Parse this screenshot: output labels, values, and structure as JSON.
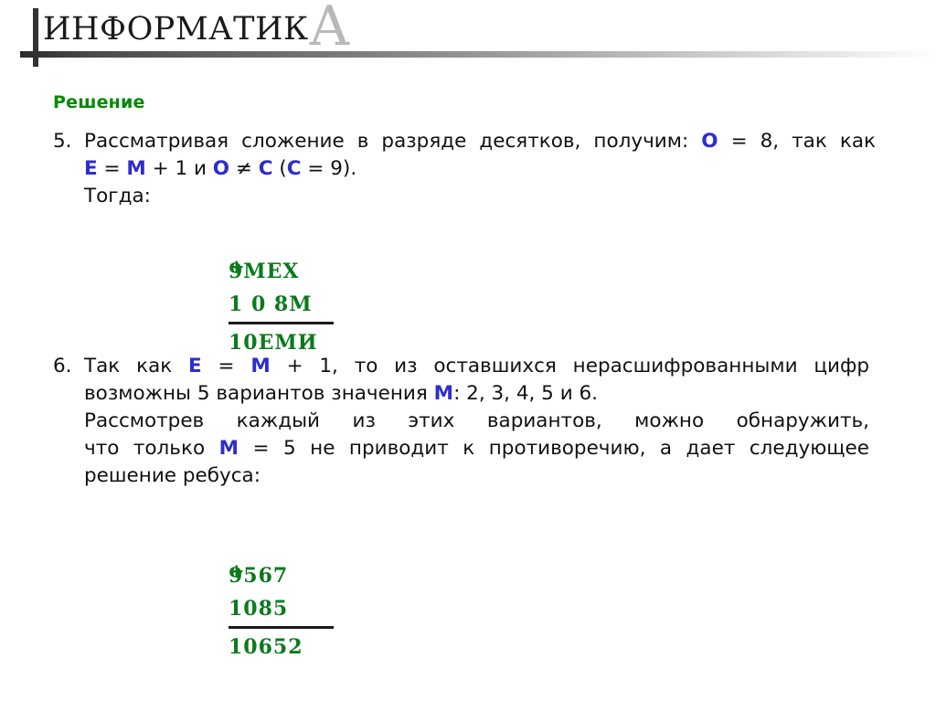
{
  "header": {
    "title_main": "ИНФОРМАТИК",
    "title_last_letter": "А",
    "rule_color_start": "#2b2b2b",
    "rule_color_end": "#ffffff",
    "bar_color": "#333333",
    "big_letter_color": "#b8b8b8"
  },
  "colors": {
    "accent_green": "#008a00",
    "sum_green": "#0a7a1c",
    "variable_blue": "#2d2dcf",
    "text_black": "#111111",
    "background": "#ffffff"
  },
  "section": {
    "title": "Решение"
  },
  "paragraphs": [
    {
      "number": "5.",
      "line1_a": "Рассматривая сложение в разряде десятков, получим: ",
      "line1_var": "О",
      "line1_b": " = 8, так как",
      "line2_v1": "Е",
      "line2_a": " = ",
      "line2_v2": "М",
      "line2_b": " + 1  и  ",
      "line2_v3": "О",
      "line2_c": " ≠ ",
      "line2_v4": "С",
      "line2_d": "  (",
      "line2_v5": "С",
      "line2_e": " = 9).",
      "line3": "Тогда:"
    },
    {
      "number": "6.",
      "line1_a": "Так как ",
      "line1_v1": "Е",
      "line1_b": " = ",
      "line1_v2": "М",
      "line1_c": " + 1, то из оставшихся нерасшифрованными цифр",
      "line2_a": "возможны 5 вариантов значения ",
      "line2_v1": "М",
      "line2_b": ":  2, 3, 4, 5 и 6.",
      "line3": "Рассмотрев каждый из этих вариантов, можно обнаружить,",
      "line4_a": "что только ",
      "line4_v1": "М",
      "line4_b": " = 5 не приводит к противоречию, а дает следующее",
      "line5": "решение ребуса:"
    }
  ],
  "sums": [
    {
      "name": "cryptarithm-letters",
      "operator": "+",
      "addend1": "9МЕХ",
      "addend2": "1 0 8М",
      "result": "10ЕМИ"
    },
    {
      "name": "cryptarithm-digits",
      "operator": "+",
      "addend1": "9567",
      "addend2": "1085",
      "result": "10652"
    }
  ]
}
